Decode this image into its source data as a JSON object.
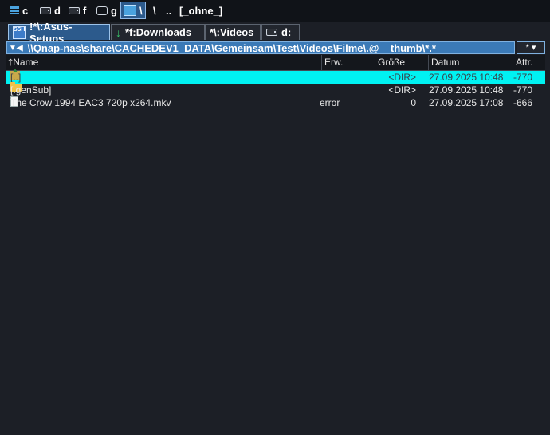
{
  "drives": [
    {
      "label": "c",
      "icon": "grid-drive-icon"
    },
    {
      "label": "d",
      "icon": "disk-drive-icon"
    },
    {
      "label": "f",
      "icon": "disk-drive-icon"
    },
    {
      "label": "g",
      "icon": "usb-drive-icon"
    },
    {
      "label": "\\",
      "icon": "network-drive-icon",
      "active": true
    },
    {
      "label": "\\"
    },
    {
      "label": ".."
    },
    {
      "label": "[_ohne_]"
    }
  ],
  "tabs": [
    {
      "label": "!*\\:Asus-Setups",
      "icon": "ssh-icon",
      "active": true
    },
    {
      "label": "*f:Downloads",
      "icon": "download-arrow-icon"
    },
    {
      "label": "*\\:Videos"
    },
    {
      "label": "d:",
      "icon": "disk-drive-icon"
    }
  ],
  "path": "\\\\Qnap-nas\\share\\CACHEDEV1_DATA\\Gemeinsam\\Test\\Videos\\Filme\\.@__thumb\\*.*",
  "star_button": "*",
  "columns": {
    "name": "Name",
    "ext": "Erw.",
    "size": "Größe",
    "date": "Datum",
    "attr": "Attr."
  },
  "files": [
    {
      "name": "[..]",
      "ext": "",
      "size": "<DIR>",
      "date": "27.09.2025 10:48",
      "attr": "-770",
      "icon": "parent-folder-icon",
      "selected": true
    },
    {
      "name": "[.genSub]",
      "ext": "",
      "size": "<DIR>",
      "date": "27.09.2025 10:48",
      "attr": "-770",
      "icon": "folder-icon"
    },
    {
      "name": "The Crow 1994 EAC3 720p x264.mkv",
      "ext": "error",
      "size": "0",
      "date": "27.09.2025 17:08",
      "attr": "-666",
      "icon": "file-icon"
    }
  ]
}
